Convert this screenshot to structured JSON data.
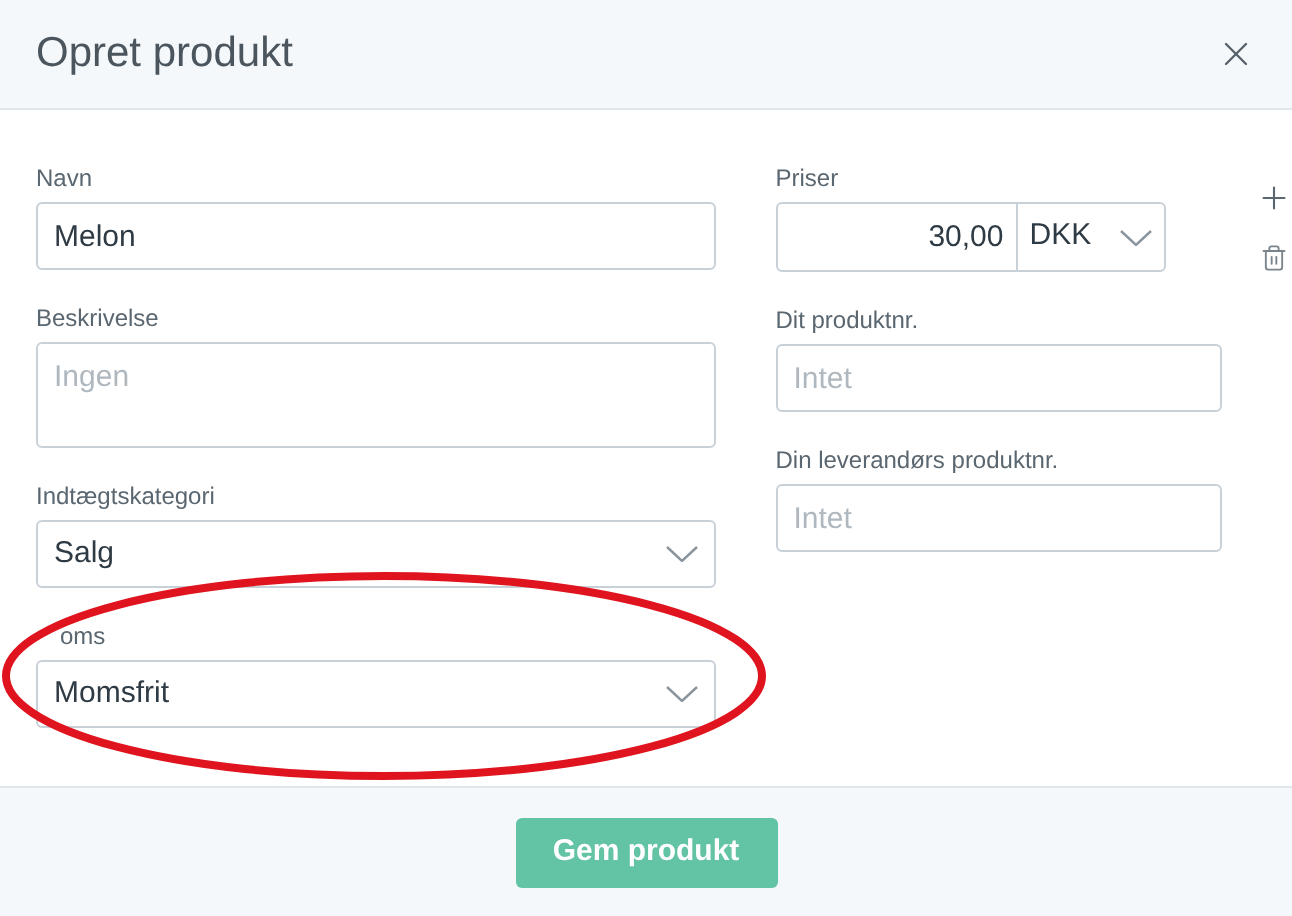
{
  "dialog": {
    "title": "Opret produkt"
  },
  "left_fields": [
    {
      "kind": "text",
      "label": "Navn",
      "value": "Melon"
    },
    {
      "kind": "textarea",
      "label": "Beskrivelse",
      "placeholder": "Ingen"
    },
    {
      "kind": "select",
      "label": "Indtægtskategori",
      "value": "Salg"
    },
    {
      "kind": "select",
      "label": "oms",
      "label_cut": true,
      "value": "Momsfrit"
    }
  ],
  "prices": {
    "label": "Priser",
    "amount": "30,00",
    "currency": "DKK"
  },
  "right_fields": [
    {
      "kind": "text",
      "label": "Dit produktnr.",
      "placeholder": "Intet"
    },
    {
      "kind": "text",
      "label": "Din leverandørs produktnr.",
      "placeholder": "Intet"
    }
  ],
  "annotation": {
    "kind": "ellipse",
    "color": "#e0141e"
  },
  "footer": {
    "button": "Gem produkt"
  }
}
